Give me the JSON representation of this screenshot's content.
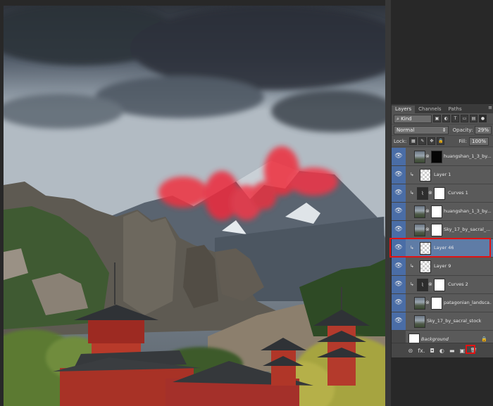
{
  "panel": {
    "tabs": [
      "Layers",
      "Channels",
      "Paths"
    ],
    "menu_icon": "≡",
    "filter_kind": "Kind",
    "blend_mode": "Normal",
    "opacity_label": "Opacity:",
    "opacity_value": "29%",
    "lock_label": "Lock:",
    "fill_label": "Fill:",
    "fill_value": "100%",
    "layers": [
      {
        "name": "huangshan_1_3_by...",
        "visible": true,
        "thumb": "photo",
        "mask": "black",
        "clipped": false
      },
      {
        "name": "Layer 1",
        "visible": true,
        "thumb": "checker",
        "mask": "",
        "clipped": true
      },
      {
        "name": "Curves 1",
        "visible": true,
        "thumb": "adjustment",
        "mask": "white",
        "clipped": true
      },
      {
        "name": "huangshan_1_3_by...",
        "visible": true,
        "thumb": "photo",
        "mask": "white",
        "clipped": false
      },
      {
        "name": "Sky_17_by_sacral_...",
        "visible": true,
        "thumb": "photo",
        "mask": "white",
        "clipped": false
      },
      {
        "name": "Layer 46",
        "visible": true,
        "thumb": "checker",
        "mask": "",
        "clipped": true,
        "selected": true
      },
      {
        "name": "Layer 9",
        "visible": true,
        "thumb": "checker",
        "mask": "",
        "clipped": true
      },
      {
        "name": "Curves 2",
        "visible": true,
        "thumb": "adjustment",
        "mask": "white",
        "clipped": true
      },
      {
        "name": "patagonian_landsca...",
        "visible": true,
        "thumb": "photo",
        "mask": "white",
        "clipped": false
      },
      {
        "name": "Sky_17_by_sacral_stock",
        "visible": true,
        "thumb": "photo",
        "mask": "",
        "clipped": false
      },
      {
        "name": "Background",
        "visible": false,
        "thumb": "white",
        "mask": "",
        "clipped": false,
        "locked": true
      }
    ],
    "footer_icons": [
      "link-icon",
      "fx-icon",
      "mask-icon",
      "adjustment-icon",
      "folder-icon",
      "new-layer-icon",
      "trash-icon"
    ],
    "footer_glyphs": [
      "⊝",
      "fx.",
      "◘",
      "◐",
      "▬",
      "▣",
      "🗑"
    ]
  },
  "colors": {
    "highlight_red": "#e01212",
    "selected_row": "#5f7ca6",
    "eye_bg": "#4a6da6"
  }
}
